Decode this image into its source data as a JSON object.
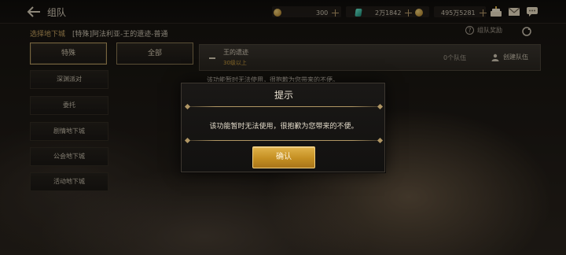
{
  "header": {
    "title": "组队",
    "currencies": [
      {
        "icon": "gold-coin-icon",
        "amount": "300"
      },
      {
        "icon": "green-gem-icon",
        "amount": "2万1842"
      },
      {
        "icon": "gold-ingot-icon",
        "amount": "495万5281"
      }
    ]
  },
  "subheader": {
    "label": "选择地下城",
    "path": "[特殊]阿法利亚-王的遗迹-普通",
    "help_label": "组队奖励"
  },
  "tabs": [
    {
      "label": "特殊",
      "active": true
    },
    {
      "label": "全部",
      "active": false
    }
  ],
  "sidebar": {
    "items": [
      {
        "label": "深渊派对"
      },
      {
        "label": "委托"
      },
      {
        "label": "剧情地下城"
      },
      {
        "label": "公会地下城"
      },
      {
        "label": "活动地下城"
      }
    ]
  },
  "dungeon": {
    "name": "王的遗迹",
    "level": "30级以上",
    "team_count": "0个队伍",
    "create_label": "创建队伍",
    "notice": "该功能暂时无法使用，很抱歉为您带来的不便。"
  },
  "modal": {
    "title": "提示",
    "message": "该功能暂时无法使用，很抱歉为您带来的不便。",
    "confirm_label": "确认"
  },
  "colors": {
    "accent_gold": "#c89a3c",
    "button_gold": "#c48f22",
    "panel_dark": "#121110"
  }
}
